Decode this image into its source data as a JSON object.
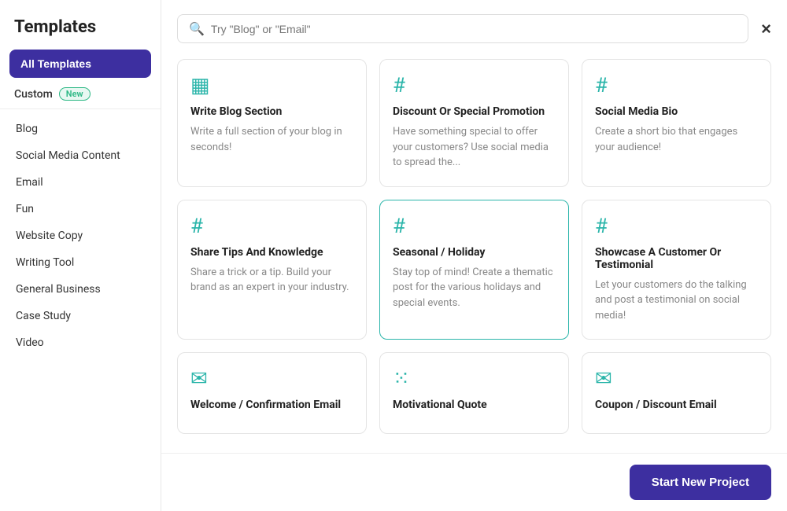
{
  "sidebar": {
    "title": "Templates",
    "all_templates_label": "All Templates",
    "custom_label": "Custom",
    "new_badge": "New",
    "nav_items": [
      {
        "label": "Blog"
      },
      {
        "label": "Social Media Content"
      },
      {
        "label": "Email"
      },
      {
        "label": "Fun"
      },
      {
        "label": "Website Copy"
      },
      {
        "label": "Writing Tool"
      },
      {
        "label": "General Business"
      },
      {
        "label": "Case Study"
      },
      {
        "label": "Video"
      }
    ]
  },
  "header": {
    "search_placeholder": "Try \"Blog\" or \"Email\"",
    "close_label": "×"
  },
  "cards": [
    {
      "icon": "▦",
      "icon_class": "teal",
      "title": "Write Blog Section",
      "desc": "Write a full section of your blog in seconds!",
      "highlighted": false
    },
    {
      "icon": "#",
      "icon_class": "teal",
      "title": "Discount Or Special Promotion",
      "desc": "Have something special to offer your customers? Use social media to spread the...",
      "highlighted": false
    },
    {
      "icon": "#",
      "icon_class": "teal",
      "title": "Social Media Bio",
      "desc": "Create a short bio that engages your audience!",
      "highlighted": false
    },
    {
      "icon": "#",
      "icon_class": "teal",
      "title": "Share Tips And Knowledge",
      "desc": "Share a trick or a tip. Build your brand as an expert in your industry.",
      "highlighted": false
    },
    {
      "icon": "#",
      "icon_class": "teal",
      "title": "Seasonal / Holiday",
      "desc": "Stay top of mind! Create a thematic post for the various holidays and special events.",
      "highlighted": true
    },
    {
      "icon": "#",
      "icon_class": "teal",
      "title": "Showcase A Customer Or Testimonial",
      "desc": "Let your customers do the talking and post a testimonial on social media!",
      "highlighted": false
    },
    {
      "icon": "✉",
      "icon_class": "teal",
      "title": "Welcome / Confirmation Email",
      "desc": "",
      "highlighted": false
    },
    {
      "icon": "⁙",
      "icon_class": "teal",
      "title": "Motivational Quote",
      "desc": "",
      "highlighted": false
    },
    {
      "icon": "✉",
      "icon_class": "teal",
      "title": "Coupon / Discount Email",
      "desc": "",
      "highlighted": false
    }
  ],
  "bottom_bar": {
    "start_label": "Start New Project"
  }
}
